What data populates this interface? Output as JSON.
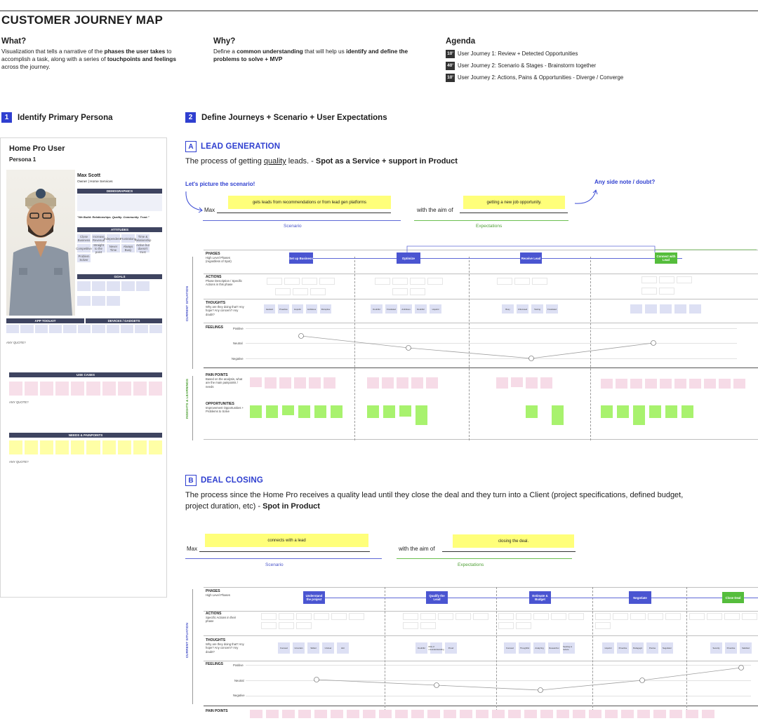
{
  "title": "CUSTOMER JOURNEY MAP",
  "what": {
    "heading": "What?",
    "text_1": "Visualization that tells a narrative of the ",
    "bold_1": "phases the user takes",
    "text_2": " to accomplish a task, along with a series of ",
    "bold_2": "touchpoints and feelings",
    "text_3": " across the journey."
  },
  "why": {
    "heading": "Why?",
    "text_1": "Define a ",
    "bold_1": "common understanding",
    "text_2": " that will help us ",
    "bold_2": "identify and define the problems to solve + MVP"
  },
  "agenda": {
    "heading": "Agenda",
    "items": [
      {
        "time": "10'",
        "label": "User Journey 1: Review + Detected Opportunities"
      },
      {
        "time": "40'",
        "label": "User Journey 2: Scenario & Stages - Brainstorm together"
      },
      {
        "time": "10'",
        "label": "User Journey 2: Actions, Pains & Opportunities - Diverge / Converge"
      }
    ]
  },
  "step1": {
    "num": "1",
    "title": "Identify Primary Persona"
  },
  "step2": {
    "num": "2",
    "title": "Define Journeys + Scenario + User Expectations"
  },
  "persona": {
    "title": "Home Pro User",
    "subtitle": "Persona 1",
    "name": "Max Scott",
    "role": "Owner | Home Services",
    "demographics": "DEMOGRAPHICS",
    "quote": "\"We Build: Relationships. Quality. Community. Trust.\"",
    "attitudes": "ATTITUDES",
    "goals": "GOALS",
    "app_toolkit": "APP TOOLKIT",
    "devices": "DEVICES / GADGETS",
    "any_quote": "ANY QUOTE?",
    "use_cases": "USE CASES",
    "needs": "NEEDS & PAINPOINTS",
    "attitude_words": [
      "Close Business",
      "Increase Revenue",
      "Independence",
      "Frustrations",
      "Time & Relationship",
      "Competitive",
      "Straight to the point",
      "Never Time",
      "Always Busy",
      "Active but doesn't trust",
      "Problem Solver"
    ]
  },
  "sectionA": {
    "letter": "A",
    "title": "LEAD GENERATION",
    "desc_1": "The process of getting ",
    "desc_u": "quality",
    "desc_2": " leads. - ",
    "desc_bold": "Spot as a Service + support in Product",
    "picture": "Let's picture the scenario!",
    "side_note": "Any side note / doubt?",
    "max": "Max",
    "scenario_note": "gets leads from recommendations or from lead gen platforms",
    "aim": "with the aim of",
    "expect_note": "getting a new job opportunity.",
    "scenario_lbl": "Scenario",
    "expect_lbl": "Expectations",
    "phases_lbl": "PHASES",
    "phases_sub": "High Level Phases (regardless of Spot)",
    "actions_lbl": "ACTIONS",
    "actions_sub": "Phase Description / Specific Actions in this phase",
    "thoughts_lbl": "THOUGHTS",
    "thoughts_sub": "Why are they doing that? Any hope? Any concern? Any doubt?",
    "feelings_lbl": "FEELINGS",
    "positive": "Positive",
    "neutral": "Neutral",
    "negative": "Negative",
    "pain_lbl": "PAIN POINTS",
    "pain_sub": "Based on the analysis, what are the main painpoints / needs",
    "opp_lbl": "OPPORTUNITIES",
    "opp_sub": "Improvement Opportunities + Problems to Solve",
    "current_situation": "CURRENT SITUATION",
    "insights": "INSIGHTS & LEARNINGS",
    "phases": [
      "Set up Business",
      "Optimize",
      "Receive Lead",
      "Connect with Lead"
    ],
    "thoughts": [
      "Hesitant",
      "Proactive",
      "Hopeful",
      "Ambitious",
      "Disruptive",
      "Doubtful",
      "Frustrated",
      "Ambitious",
      "Doubtful",
      "Hopeful",
      "Busy",
      "Unfocused",
      "Testing",
      "Frustrated"
    ]
  },
  "sectionB": {
    "letter": "B",
    "title": "DEAL CLOSING",
    "desc_1": "The process since the Home Pro receives a quality lead until they close the deal and they turn into a Client (project specifications, defined budget, project duration, etc) - ",
    "desc_bold": "Spot in Product",
    "max": "Max",
    "scenario_note": "connects with a lead",
    "aim": "with the aim of",
    "expect_note": "closing the deal.",
    "scenario_lbl": "Scenario",
    "expect_lbl": "Expectations",
    "phases_lbl": "PHASES",
    "phases_sub": "High Level Phases",
    "actions_lbl": "ACTIONS",
    "actions_sub": "Specific Actions in their phase",
    "thoughts_lbl": "THOUGHTS",
    "thoughts_sub": "Why are they doing that? Any hope? Any concern? Any doubt?",
    "feelings_lbl": "FEELINGS",
    "positive": "Positive",
    "neutral": "Neutral",
    "negative": "Negative",
    "pain_lbl": "PAIN POINTS",
    "current_situation": "CURRENT SITUATION",
    "phases": [
      "Understand the project",
      "Qualify the Lead",
      "Estimate & Budget",
      "Negotiate",
      "Close Deal"
    ],
    "thoughts": [
      "Focused",
      "Uncertain",
      "Skilled",
      "Unclear",
      "Hint",
      "Doubtful",
      "Risk of misunderstanding",
      "Proud",
      "Focused",
      "Thoughtful",
      "Analyzing",
      "Researcher",
      "Seeking to reduce",
      "Hopeful",
      "Proactive",
      "Pedagogic",
      "Precise",
      "Negotiator",
      "Security",
      "Proactive",
      "Satisfied"
    ]
  },
  "colors": {
    "accent": "#2f3fd0",
    "phase_blue": "#4a55d1",
    "phase_green": "#55bd3c",
    "sticky_yellow": "#ffff7a",
    "pain_pink": "#f6dbe7",
    "opp_green": "#a8f26e",
    "thought_lavender": "#dde0f4"
  }
}
